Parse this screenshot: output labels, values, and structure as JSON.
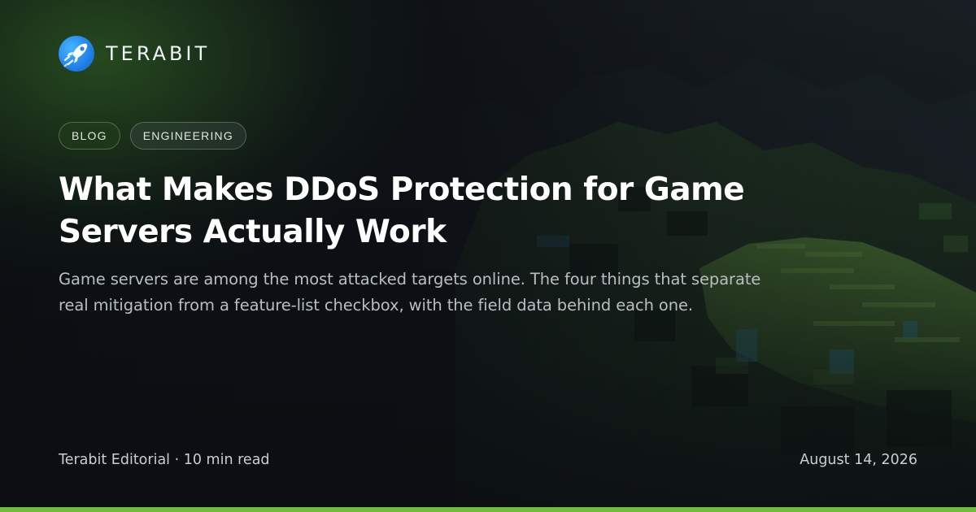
{
  "brand": {
    "name": "TERABIT",
    "logo_icon": "rocket-icon",
    "logo_color": "#2e8ef0"
  },
  "tags": [
    {
      "label": "BLOG"
    },
    {
      "label": "ENGINEERING"
    }
  ],
  "article": {
    "title": "What Makes DDoS Protection for Game Servers Actually Work",
    "description": "Game servers are among the most attacked targets online. The four things that separate real mitigation from a feature-list checkbox, with the field data behind each one.",
    "author": "Terabit Editorial",
    "read_time": "10 min read",
    "meta_line": "Terabit Editorial · 10 min read",
    "date": "August 14, 2026"
  },
  "colors": {
    "accent": "#6fbe3c",
    "background": "#0c0f13"
  }
}
